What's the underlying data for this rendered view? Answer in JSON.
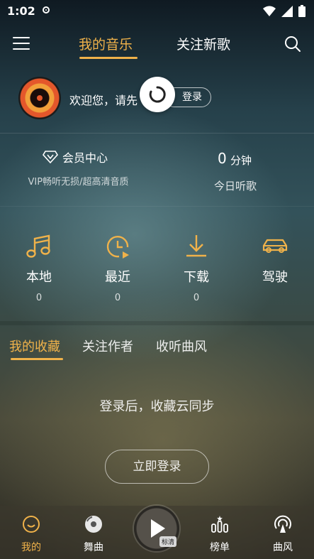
{
  "status_bar": {
    "time": "1:02"
  },
  "top_nav": {
    "tabs": [
      {
        "label": "我的音乐",
        "active": true
      },
      {
        "label": "关注新歌",
        "active": false
      }
    ]
  },
  "user": {
    "welcome_text": "欢迎您，请先",
    "login_label": "登录"
  },
  "vip": {
    "title": "会员中心",
    "subtitle": "VIP畅听无损/超高清音质"
  },
  "listen_today": {
    "value": "0",
    "unit": "分钟",
    "label": "今日听歌"
  },
  "quick_items": [
    {
      "label": "本地",
      "count": "0",
      "icon": "music-note-icon"
    },
    {
      "label": "最近",
      "count": "0",
      "icon": "clock-play-icon"
    },
    {
      "label": "下载",
      "count": "0",
      "icon": "download-icon"
    },
    {
      "label": "驾驶",
      "count": "",
      "icon": "car-icon"
    }
  ],
  "collection_tabs": [
    {
      "label": "我的收藏",
      "active": true
    },
    {
      "label": "关注作者",
      "active": false
    },
    {
      "label": "收听曲风",
      "active": false
    }
  ],
  "empty_state": {
    "message": "登录后，收藏云同步",
    "button_label": "立即登录"
  },
  "player": {
    "quality": "标清"
  },
  "bottom_nav": [
    {
      "label": "我的",
      "icon": "smile-icon",
      "active": true
    },
    {
      "label": "舞曲",
      "icon": "disc-icon",
      "active": false
    },
    {
      "label": "榜单",
      "icon": "chart-icon",
      "active": false
    },
    {
      "label": "曲风",
      "icon": "radio-icon",
      "active": false
    }
  ],
  "colors": {
    "accent": "#f0b24a"
  }
}
